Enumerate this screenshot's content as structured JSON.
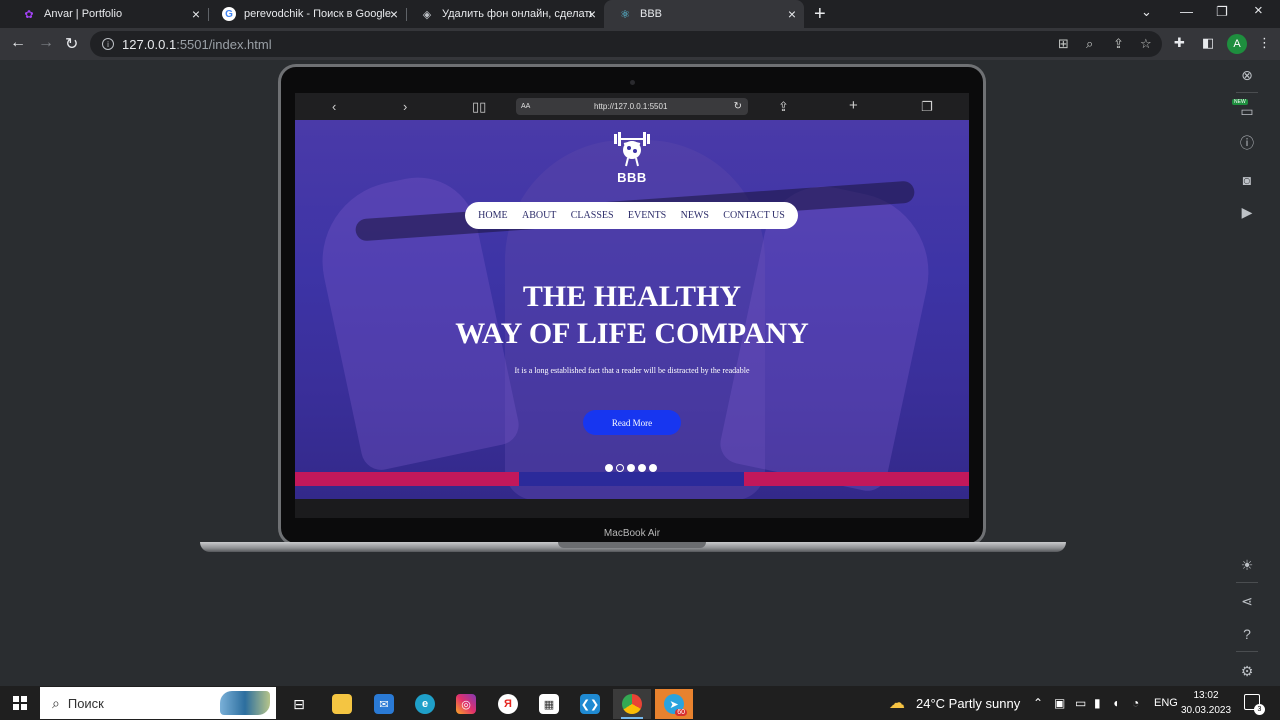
{
  "browser": {
    "tabs": [
      {
        "label": "Anvar | Portfolio",
        "icon": "portfolio-icon"
      },
      {
        "label": "perevodchik - Поиск в Google",
        "icon": "google-icon"
      },
      {
        "label": "Удалить фон онлайн, сделать пр",
        "icon": "layers-icon"
      },
      {
        "label": "BBB",
        "icon": "react-icon"
      }
    ],
    "active_tab": 3,
    "url_host": "127.0.0.1",
    "url_path": ":5501/index.html",
    "profile_initial": "A"
  },
  "device": {
    "label": "MacBook Air",
    "safari_url": "http://127.0.0.1:5501",
    "safari_aa": "AA"
  },
  "site": {
    "logo_text": "BBB",
    "nav": [
      "HOME",
      "ABOUT",
      "CLASSES",
      "EVENTS",
      "NEWS",
      "CONTACT US"
    ],
    "headline_line1": "THE HEALTHY",
    "headline_line2": "WAY OF LIFE COMPANY",
    "subtitle": "It is a long established fact that a reader will be distracted by the readable",
    "cta": "Read More",
    "slides_total": 5,
    "slide_active": 2,
    "strip_colors": [
      "#c2185b",
      "#2b2a9a",
      "#c2185b"
    ],
    "hero_color": "#3d34a6",
    "button_color": "#1736f0"
  },
  "taskbar": {
    "search_placeholder": "Поиск",
    "weather": "24°C  Partly sunny",
    "language": "ENG",
    "time": "13:02",
    "date": "30.03.2023",
    "telegram_badge": "60",
    "notifications": "3"
  }
}
